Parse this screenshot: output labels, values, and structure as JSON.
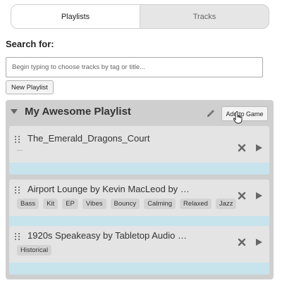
{
  "tabs": [
    {
      "label": "Playlists",
      "active": true
    },
    {
      "label": "Tracks",
      "active": false
    }
  ],
  "search": {
    "label": "Search for:",
    "placeholder": "Begin typing to choose tracks by tag or title..."
  },
  "new_playlist_label": "New Playlist",
  "playlist": {
    "title": "My Awesome Playlist",
    "add_to_game_label": "Add to Game",
    "tracks": [
      {
        "title": "The_Emerald_Dragons_Court",
        "tags": []
      },
      {
        "title": "Airport Lounge by Kevin MacLeod by …",
        "tags": [
          "Bass",
          "Kit",
          "EP",
          "Vibes",
          "Bouncy",
          "Calming",
          "Relaxed",
          "Jazz"
        ]
      },
      {
        "title": "1920s Speakeasy by Tabletop Audio …",
        "tags": [
          "Historical"
        ]
      }
    ]
  },
  "colors": {
    "panel_bg": "#cfcfcf",
    "track_bg": "#e4e4e4",
    "progress_strip": "#c7e3ec",
    "tag_bg": "#d3d3d3"
  },
  "icons": {
    "collapse": "caret-down-icon",
    "edit": "pencil-icon",
    "drag": "drag-handle-icon",
    "remove": "close-icon",
    "play": "play-icon",
    "cursor": "hand-pointer-icon"
  }
}
